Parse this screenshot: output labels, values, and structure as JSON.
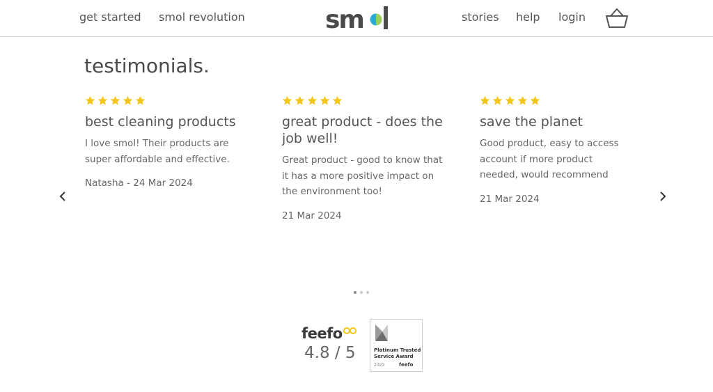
{
  "header": {
    "nav_left": [
      "get started",
      "smol revolution"
    ],
    "logo": "smol",
    "nav_right": [
      "stories",
      "help",
      "login"
    ],
    "accent_colors": {
      "logo_dot_blue": "#2aa9d8",
      "logo_dot_green": "#9ad15a"
    }
  },
  "testimonials": {
    "heading": "testimonials.",
    "star_color": "#f5c518",
    "cards": [
      {
        "stars": 5,
        "title": "best cleaning products",
        "body": "I love smol! Their products are super affordable and effective.",
        "meta": "Natasha - 24 Mar 2024"
      },
      {
        "stars": 5,
        "title": "great product - does the job well!",
        "body": "Great product - good to know that it has a more positive impact on the environment too!",
        "meta": "21 Mar 2024"
      },
      {
        "stars": 5,
        "title": "save the planet",
        "body": "Good product, easy to access account if more product needed, would recommend",
        "meta": "21 Mar 2024"
      }
    ],
    "carousel": {
      "prev_icon": "chevron-left-icon",
      "next_icon": "chevron-right-icon",
      "page_count": 3,
      "active_page": 1
    }
  },
  "feefo": {
    "logo": "feefo",
    "rating": "4.8 / 5",
    "award": {
      "title": "Platinum Trusted Service Award",
      "year": "2023",
      "brand": "feefo"
    }
  }
}
